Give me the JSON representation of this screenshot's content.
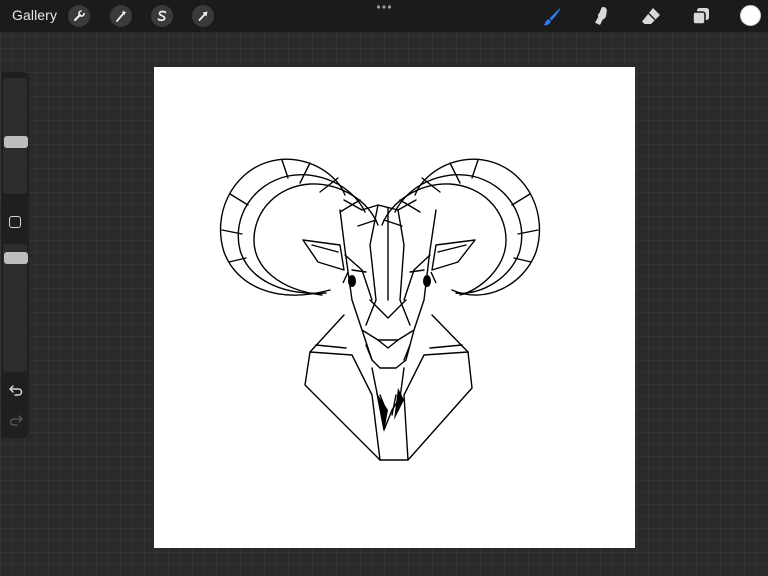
{
  "topbar": {
    "gallery_label": "Gallery",
    "left_tools": [
      {
        "name": "actions",
        "icon": "wrench-icon"
      },
      {
        "name": "adjustments",
        "icon": "magic-wand-icon"
      },
      {
        "name": "selection",
        "icon": "selection-s-icon"
      },
      {
        "name": "transform",
        "icon": "arrow-cursor-icon"
      }
    ],
    "more_icon": "more-dots-icon",
    "right_tools": [
      {
        "name": "brush",
        "icon": "brush-icon",
        "active": true
      },
      {
        "name": "smudge",
        "icon": "smudge-finger-icon",
        "active": false
      },
      {
        "name": "eraser",
        "icon": "eraser-icon",
        "active": false
      },
      {
        "name": "layers",
        "icon": "layers-icon",
        "active": false
      }
    ],
    "current_color": "#ffffff"
  },
  "sidebar": {
    "brush_size_icon": "brush-size-slider",
    "opacity_icon": "opacity-slider",
    "modify_icon": "square-modify-icon",
    "undo_icon": "undo-arrow-icon",
    "redo_icon": "redo-arrow-icon"
  },
  "theme": {
    "accent": "#2f7cf6",
    "background": "#2a2a2b",
    "toolbar": "#1b1b1c",
    "canvas": "#ffffff",
    "ink": "#000000"
  }
}
